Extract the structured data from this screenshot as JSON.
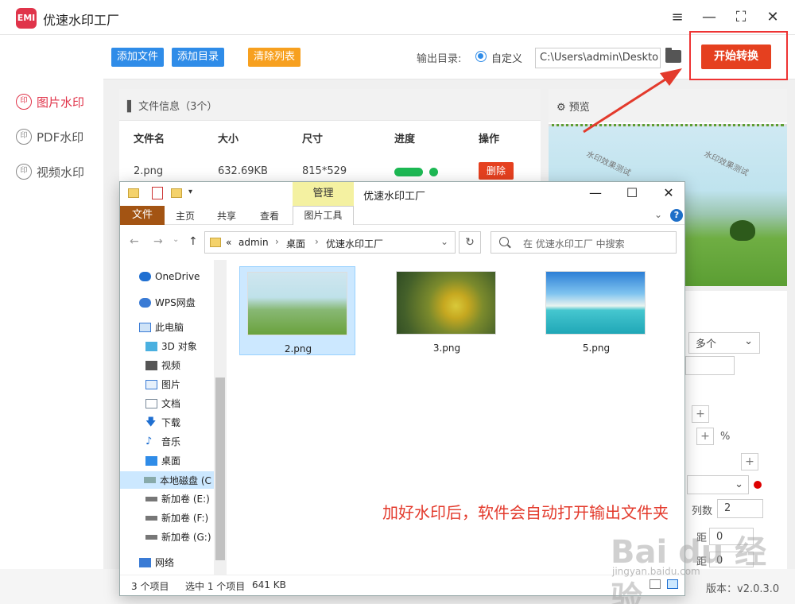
{
  "app": {
    "logo_text": "EMI",
    "title": "优速水印工厂",
    "menu_icon": "≡",
    "minimize_icon": "—",
    "maximize_icon": "⛶",
    "close_icon": "✕"
  },
  "sidebar": {
    "items": [
      {
        "label": "图片水印",
        "icon": "image-watermark-icon",
        "active": true
      },
      {
        "label": "PDF水印",
        "icon": "pdf-watermark-icon",
        "active": false
      },
      {
        "label": "视频水印",
        "icon": "video-watermark-icon",
        "active": false
      }
    ]
  },
  "toolbar": {
    "add_file": "添加文件",
    "add_dir": "添加目录",
    "clear_list": "清除列表",
    "output_label": "输出目录:",
    "radio_label": "自定义",
    "output_path": "C:\\Users\\admin\\Deskto",
    "start": "开始转换"
  },
  "file_info": {
    "header": "文件信息（3个）",
    "columns": [
      "文件名",
      "大小",
      "尺寸",
      "进度",
      "操作"
    ],
    "rows": [
      {
        "name": "2.png",
        "size": "632.69KB",
        "dims": "815*529",
        "progress": 1.0,
        "action": "删除"
      }
    ]
  },
  "preview": {
    "header": "预览",
    "watermark_text": "水印效果测试"
  },
  "settings": {
    "count_select": "多个",
    "percent": "%",
    "cols_label": "列数",
    "cols_value": "2",
    "spacing_value_1": "0",
    "spacing_value_2": "0",
    "plus": "+",
    "label_distance_1": "距",
    "label_distance_2": "距"
  },
  "version": "版本：v2.0.3.0",
  "explorer": {
    "manage_tab": "管理",
    "window_title": "优速水印工厂",
    "ribbon": [
      "文件",
      "主页",
      "共享",
      "查看"
    ],
    "ribbon_tools": "图片工具",
    "address": [
      "«",
      "admin",
      "桌面",
      "优速水印工厂"
    ],
    "search_placeholder": "在 优速水印工厂 中搜索",
    "nav": [
      {
        "label": "OneDrive",
        "icon": "cloud-icon"
      },
      {
        "label": "WPS网盘",
        "icon": "cloud-icon"
      },
      {
        "label": "此电脑",
        "icon": "computer-icon"
      },
      {
        "label": "3D 对象",
        "icon": "cube-icon"
      },
      {
        "label": "视频",
        "icon": "video-icon"
      },
      {
        "label": "图片",
        "icon": "picture-icon"
      },
      {
        "label": "文档",
        "icon": "document-icon"
      },
      {
        "label": "下载",
        "icon": "download-icon"
      },
      {
        "label": "音乐",
        "icon": "music-icon"
      },
      {
        "label": "桌面",
        "icon": "desktop-icon"
      },
      {
        "label": "本地磁盘 (C",
        "icon": "disk-icon"
      },
      {
        "label": "新加卷 (E:)",
        "icon": "drive-icon"
      },
      {
        "label": "新加卷 (F:)",
        "icon": "drive-icon"
      },
      {
        "label": "新加卷 (G:)",
        "icon": "drive-icon"
      },
      {
        "label": "网络",
        "icon": "network-icon"
      }
    ],
    "files": [
      {
        "name": "2.png",
        "selected": true
      },
      {
        "name": "3.png",
        "selected": false
      },
      {
        "name": "5.png",
        "selected": false
      }
    ],
    "annotation": "加好水印后，软件会自动打开输出文件夹",
    "status_count": "3 个项目",
    "status_selected": "选中 1 个项目",
    "status_size": "641 KB"
  },
  "watermark": {
    "brand": "Bai du 经验",
    "url": "jingyan.baidu.com"
  },
  "colors": {
    "accent_red": "#e5401f",
    "blue": "#2f8ce8",
    "orange": "#f7a01f",
    "annotation_red": "#e33a2c"
  }
}
